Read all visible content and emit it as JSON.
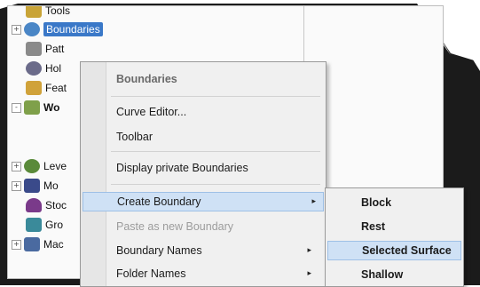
{
  "tree": {
    "items": [
      {
        "label": "Tools",
        "expander": "",
        "icon_color": "#c9a437",
        "selected": false
      },
      {
        "label": "Boundaries",
        "expander": "+",
        "icon_color": "#4a86c6",
        "selected": true
      },
      {
        "label": "Patt",
        "expander": "",
        "icon_color": "#8a8a8a",
        "selected": false
      },
      {
        "label": "Hol",
        "expander": "",
        "icon_color": "#6b6b8a",
        "selected": false
      },
      {
        "label": "Feat",
        "expander": "",
        "icon_color": "#d0a23a",
        "selected": false
      },
      {
        "label": "Wo",
        "expander": "-",
        "icon_color": "#7fa04a",
        "selected": false
      },
      {
        "label": "Leve",
        "expander": "+",
        "icon_color": "#5a8a3a",
        "selected": false
      },
      {
        "label": "Mo",
        "expander": "+",
        "icon_color": "#3a4a8a",
        "selected": false
      },
      {
        "label": "Stoc",
        "expander": "",
        "icon_color": "#7a3a8a",
        "selected": false
      },
      {
        "label": "Gro",
        "expander": "",
        "icon_color": "#3a8a9a",
        "selected": false
      },
      {
        "label": "Mac",
        "expander": "+",
        "icon_color": "#4a6aa0",
        "selected": false
      }
    ]
  },
  "menu": {
    "header": "Boundaries",
    "curve_editor": "Curve Editor...",
    "toolbar": "Toolbar",
    "display_private": "Display private Boundaries",
    "create_boundary": "Create Boundary",
    "paste_as_new": "Paste as new Boundary",
    "boundary_names": "Boundary Names",
    "folder_names": "Folder Names",
    "arrow": "▸"
  },
  "submenu": {
    "block": "Block",
    "rest": "Rest",
    "selected_surface": "Selected Surface",
    "shallow": "Shallow"
  }
}
